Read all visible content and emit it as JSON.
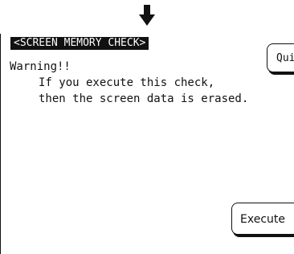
{
  "indicator": {
    "icon": "down-arrow-icon"
  },
  "screen": {
    "title": "<SCREEN MEMORY CHECK>",
    "quit_label": "Quit",
    "warning_label": "Warning!!",
    "message_lines": [
      "If you execute this check,",
      "then the screen data is erased."
    ],
    "execute_label": "Execute"
  }
}
